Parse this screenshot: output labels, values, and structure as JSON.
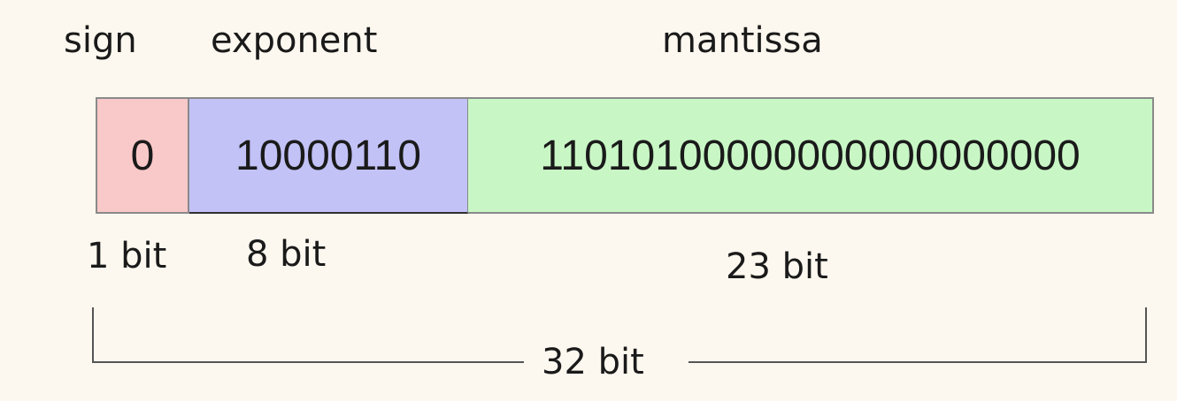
{
  "headers": {
    "sign": "sign",
    "exponent": "exponent",
    "mantissa": "mantissa"
  },
  "fields": {
    "sign": {
      "value": "0",
      "bits": "1 bit",
      "color": "#f9c8c8"
    },
    "exponent": {
      "value": "10000110",
      "bits": "8 bit",
      "color": "#c2c2f7"
    },
    "mantissa": {
      "value": "11010100000000000000000",
      "bits": "23 bit",
      "color": "#c8f7c5"
    }
  },
  "total": "32 bit"
}
